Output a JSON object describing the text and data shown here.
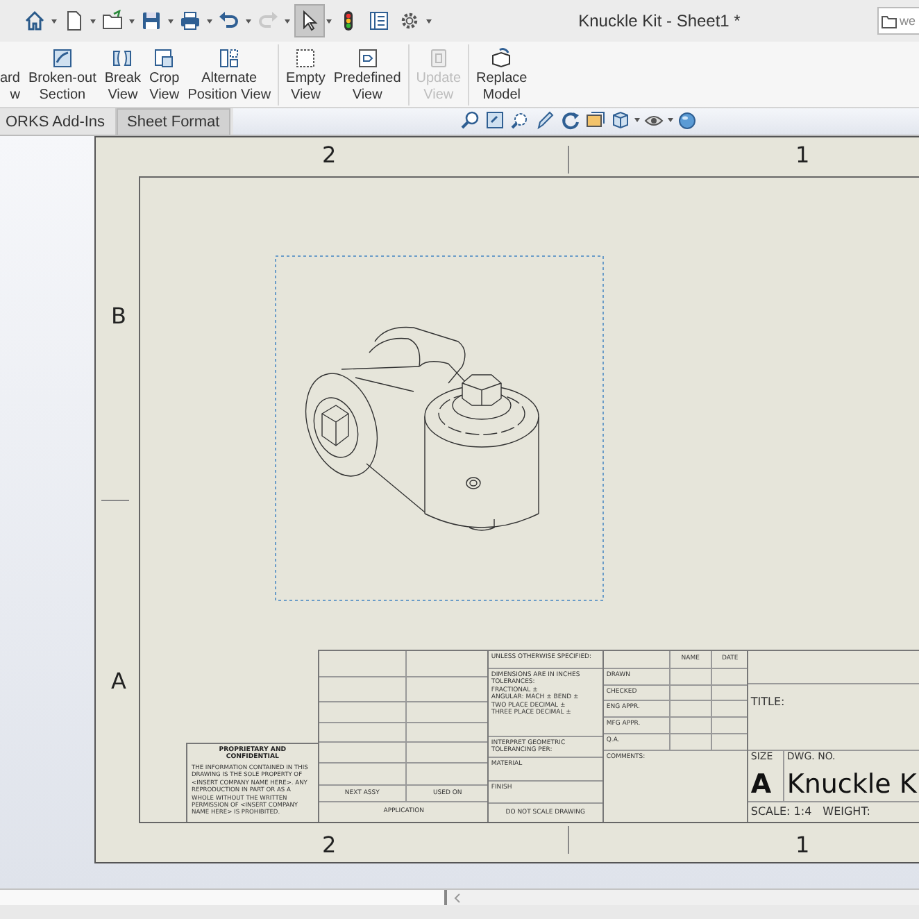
{
  "window": {
    "title": "Knuckle Kit - Sheet1 *"
  },
  "search": {
    "placeholder": "we"
  },
  "ribbon": {
    "buttons": [
      {
        "kind": "cut",
        "lines": [
          "ard",
          "w"
        ],
        "disabled": false
      },
      {
        "kind": "broken-out",
        "lines": [
          "Broken-out",
          "Section"
        ],
        "disabled": false
      },
      {
        "kind": "break",
        "lines": [
          "Break",
          "View"
        ],
        "disabled": false
      },
      {
        "kind": "crop",
        "lines": [
          "Crop",
          "View"
        ],
        "disabled": false
      },
      {
        "kind": "alternate",
        "lines": [
          "Alternate",
          "Position View"
        ],
        "disabled": false
      },
      {
        "kind": "empty",
        "lines": [
          "Empty",
          "View"
        ],
        "disabled": false
      },
      {
        "kind": "predefined",
        "lines": [
          "Predefined",
          "View"
        ],
        "disabled": false
      },
      {
        "kind": "update",
        "lines": [
          "Update",
          "View"
        ],
        "disabled": true
      },
      {
        "kind": "replace",
        "lines": [
          "Replace",
          "Model"
        ],
        "disabled": false
      }
    ]
  },
  "tabs": [
    {
      "label": "ORKS Add-Ins",
      "selected": false
    },
    {
      "label": "Sheet Format",
      "selected": true
    }
  ],
  "sheet": {
    "top_zones": [
      "2",
      "1"
    ],
    "side_zones": [
      "B",
      "A"
    ],
    "bottom_zones": [
      "2",
      "1"
    ],
    "title_block": {
      "proprietary": {
        "heading": "PROPRIETARY AND CONFIDENTIAL",
        "text": "THE INFORMATION CONTAINED IN THIS DRAWING IS THE SOLE PROPERTY OF <INSERT COMPANY NAME HERE>.  ANY REPRODUCTION IN PART OR AS A WHOLE WITHOUT THE WRITTEN PERMISSION OF <INSERT COMPANY NAME HERE> IS PROHIBITED."
      },
      "next_assy": "NEXT ASSY",
      "used_on": "USED ON",
      "application": "APPLICATION",
      "unless": "UNLESS OTHERWISE SPECIFIED:",
      "tolerances": [
        "DIMENSIONS ARE IN INCHES",
        "TOLERANCES:",
        "FRACTIONAL ±",
        "ANGULAR: MACH ±    BEND ±",
        "TWO PLACE DECIMAL    ±",
        "THREE PLACE DECIMAL  ±"
      ],
      "interpret": "INTERPRET GEOMETRIC TOLERANCING PER:",
      "material": "MATERIAL",
      "finish": "FINISH",
      "do_not_scale": "DO NOT SCALE DRAWING",
      "name_header": "NAME",
      "date_header": "DATE",
      "approvals": [
        "DRAWN",
        "CHECKED",
        "ENG APPR.",
        "MFG APPR.",
        "Q.A."
      ],
      "comments": "COMMENTS:",
      "title_label": "TITLE:",
      "size_label": "SIZE",
      "dwg_no_label": "DWG.  NO.",
      "size": "A",
      "dwg_no": "Knuckle K",
      "scale": "SCALE: 1:4",
      "weight": "WEIGHT:"
    }
  }
}
